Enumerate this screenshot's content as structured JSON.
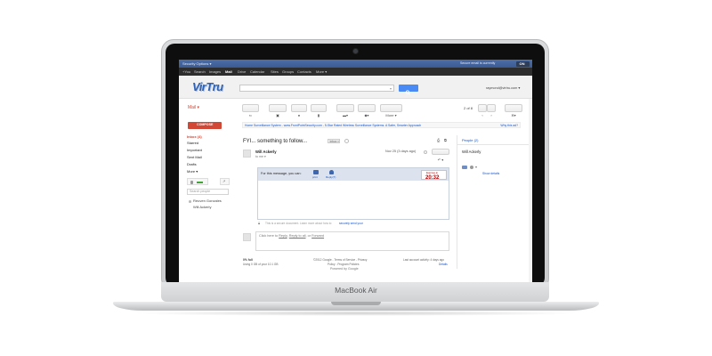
{
  "device": {
    "model_label": "MacBook Air"
  },
  "security_bar": {
    "label": "Security Options ▾",
    "status_text": "Secure email is currently",
    "toggle": "ON"
  },
  "google_bar": {
    "items": [
      "+You",
      "Search",
      "Images",
      "Mail",
      "Drive",
      "Calendar",
      "Sites",
      "Groups",
      "Contacts",
      "More ▾"
    ],
    "active": "Mail"
  },
  "header": {
    "logo_text": "VirTru",
    "search_placeholder": "",
    "account": "raymond@virtru.com ▾"
  },
  "mail_label": "Mail ▾",
  "toolbar": {
    "more_label": "More ▾",
    "pager": "2 of 8"
  },
  "sidebar": {
    "compose_label": "COMPOSE",
    "folders": [
      "Inbox (4)",
      "Starred",
      "Important",
      "Sent Mail",
      "Drafts",
      "More ▾"
    ],
    "search_people_placeholder": "Search people",
    "contacts": [
      "Reuven Gonzales",
      "Will Ackerly"
    ]
  },
  "banner": {
    "text": "Home Surveillance System - www.FrontPointSecurity.com - 5-Star Rated Wireless Surveillance Systems. A Safer, Smarter Approach",
    "why_link": "Why this ad?"
  },
  "thread": {
    "subject": "FYI... something to follow...",
    "label_chip": "Inbox ×",
    "sender": "Will Ackerly",
    "to_line": "to me ▾",
    "date": "Nov 25 (3 days ago)"
  },
  "secure_msg": {
    "prompt": "For this message, you can:",
    "actions": [
      "print",
      "Reply(7)"
    ],
    "expires_label": "Expires in",
    "expires_value": "20:32",
    "footer_text": "This is a secure document. Learn more about how to",
    "footer_link": "securely send your"
  },
  "reply_box": {
    "prefix": "Click here to",
    "reply": "Reply",
    "sep1": ",",
    "reply_all": "Reply to all",
    "sep2": ", or",
    "forward": "Forward"
  },
  "footer": {
    "usage_title": "0% full",
    "usage_detail": "Using 0 GB of your 10.1 GB",
    "copyright": "©2012 Google - Terms of Service - Privacy",
    "policy": "Policy - Program Policies",
    "powered": "Powered by Google",
    "activity": "Last account activity: 4 days ago",
    "details": "Details"
  },
  "people_panel": {
    "title": "People (2)",
    "person": "Will Ackerly",
    "show_details": "Show details"
  },
  "colors": {
    "security_bar": "#3f5f98",
    "google_bar": "#2d2d2d",
    "compose": "#d14836",
    "search_button": "#4a8af4",
    "timer": "#b00000"
  }
}
